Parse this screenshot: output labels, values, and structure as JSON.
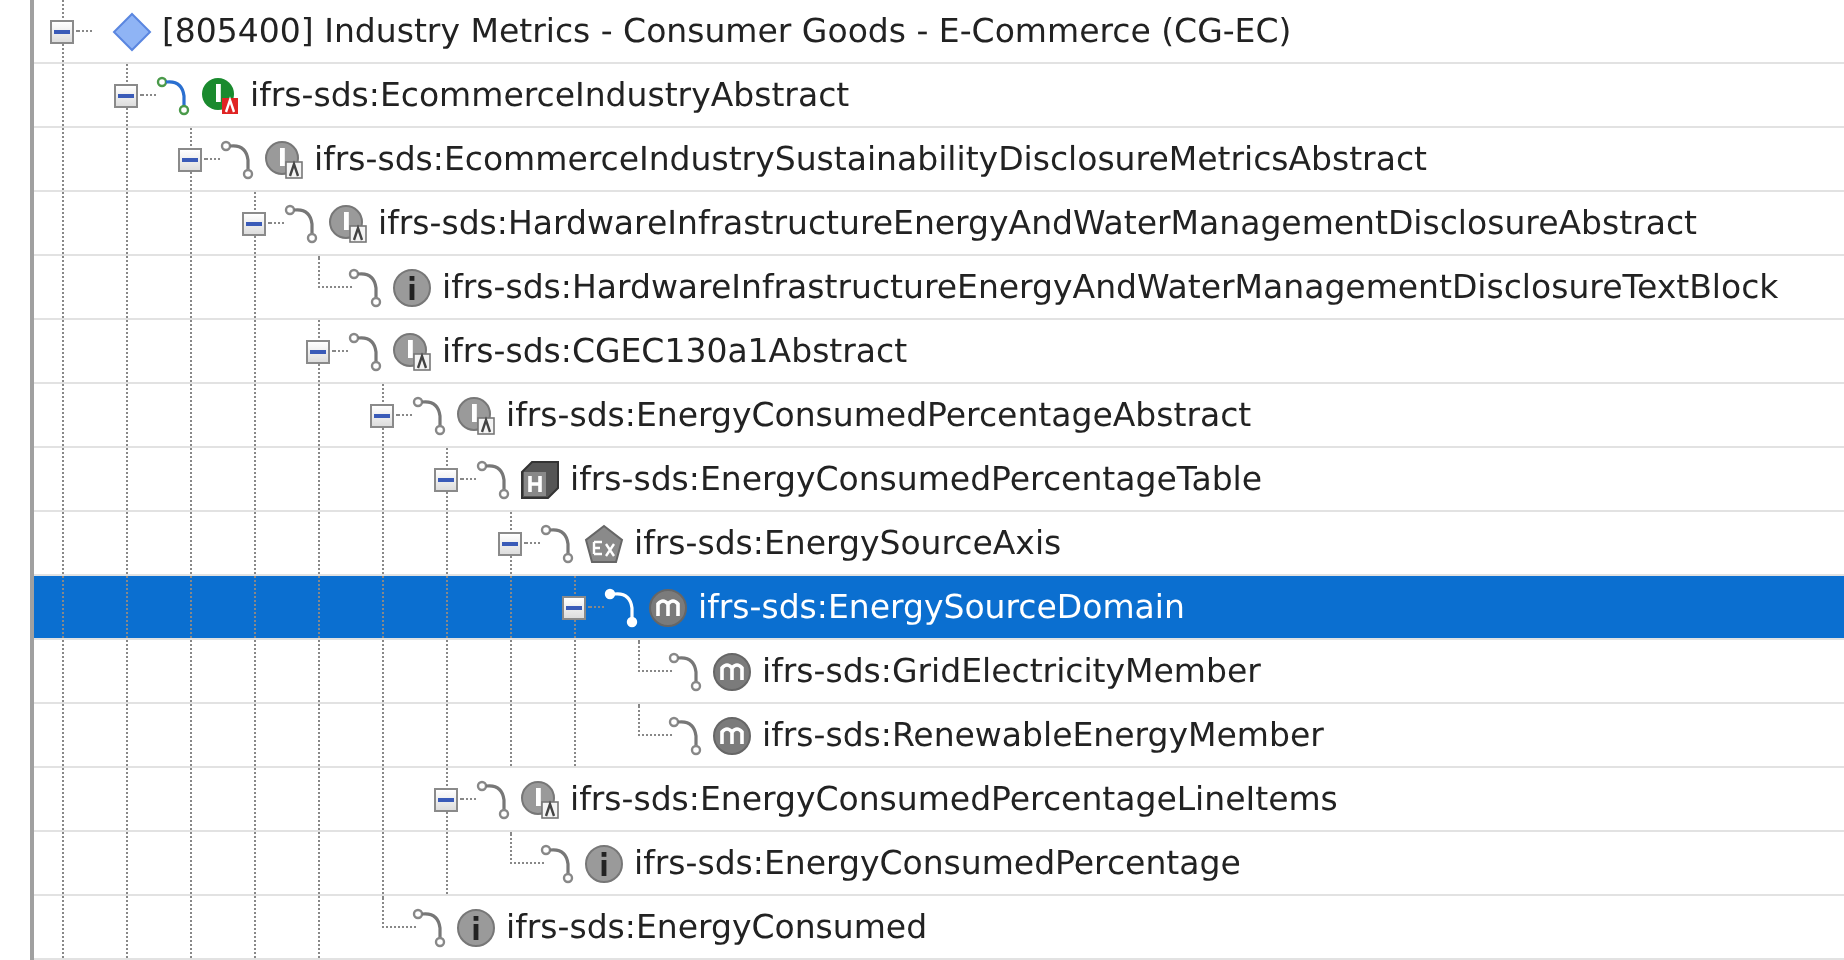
{
  "tree": [
    {
      "label": "[805400] Industry Metrics - Consumer Goods - E-Commerce (CG-EC)",
      "kind": "role",
      "expanded": true,
      "selected": false,
      "children": [
        {
          "label": "ifrs-sds:EcommerceIndustryAbstract",
          "kind": "primary-abstract",
          "expanded": true,
          "selected": false,
          "children": [
            {
              "label": "ifrs-sds:EcommerceIndustrySustainabilityDisclosureMetricsAbstract",
              "kind": "abstract",
              "expanded": true,
              "selected": false,
              "children": [
                {
                  "label": "ifrs-sds:HardwareInfrastructureEnergyAndWaterManagementDisclosureAbstract",
                  "kind": "abstract",
                  "expanded": true,
                  "selected": false,
                  "children": [
                    {
                      "label": "ifrs-sds:HardwareInfrastructureEnergyAndWaterManagementDisclosureTextBlock",
                      "kind": "item",
                      "selected": false
                    },
                    {
                      "label": "ifrs-sds:CGEC130a1Abstract",
                      "kind": "abstract",
                      "expanded": true,
                      "selected": false,
                      "children": [
                        {
                          "label": "ifrs-sds:EnergyConsumedPercentageAbstract",
                          "kind": "abstract",
                          "expanded": true,
                          "selected": false,
                          "children": [
                            {
                              "label": "ifrs-sds:EnergyConsumedPercentageTable",
                              "kind": "table",
                              "expanded": true,
                              "selected": false,
                              "children": [
                                {
                                  "label": "ifrs-sds:EnergySourceAxis",
                                  "kind": "axis",
                                  "expanded": true,
                                  "selected": false,
                                  "children": [
                                    {
                                      "label": "ifrs-sds:EnergySourceDomain",
                                      "kind": "member",
                                      "expanded": true,
                                      "selected": true,
                                      "children": [
                                        {
                                          "label": "ifrs-sds:GridElectricityMember",
                                          "kind": "member",
                                          "selected": false
                                        },
                                        {
                                          "label": "ifrs-sds:RenewableEnergyMember",
                                          "kind": "member",
                                          "selected": false
                                        }
                                      ]
                                    }
                                  ]
                                }
                              ]
                            },
                            {
                              "label": "ifrs-sds:EnergyConsumedPercentageLineItems",
                              "kind": "abstract",
                              "expanded": true,
                              "selected": false,
                              "children": [
                                {
                                  "label": "ifrs-sds:EnergyConsumedPercentage",
                                  "kind": "item",
                                  "selected": false
                                }
                              ]
                            }
                          ]
                        },
                        {
                          "label": "ifrs-sds:EnergyConsumed",
                          "kind": "item",
                          "selected": false
                        }
                      ]
                    }
                  ]
                }
              ]
            }
          ]
        }
      ]
    }
  ]
}
